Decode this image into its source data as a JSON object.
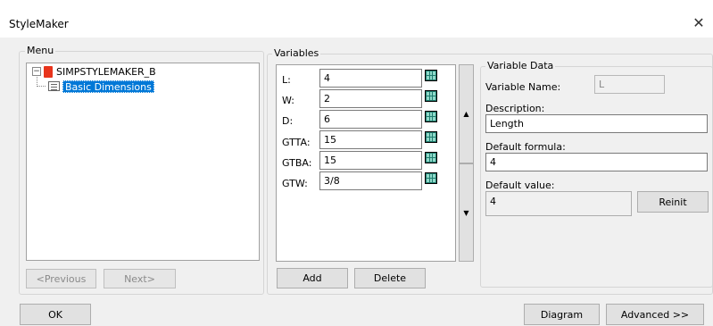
{
  "window": {
    "title": "StyleMaker",
    "close_glyph": "✕"
  },
  "menu": {
    "group_label": "Menu",
    "tree": {
      "root_label": "SIMPSTYLEMAKER_B",
      "root_toggle": "⊟",
      "child_label": "Basic Dimensions"
    },
    "previous_label": "<Previous",
    "next_label": "Next>"
  },
  "variables": {
    "group_label": "Variables",
    "rows": [
      {
        "name": "L:",
        "value": "4"
      },
      {
        "name": "W:",
        "value": "2"
      },
      {
        "name": "D:",
        "value": "6"
      },
      {
        "name": "GTTA:",
        "value": "15"
      },
      {
        "name": "GTBA:",
        "value": "15"
      },
      {
        "name": "GTW:",
        "value": "3/8"
      }
    ],
    "up_glyph": "▲",
    "down_glyph": "▼",
    "add_label": "Add",
    "delete_label": "Delete"
  },
  "variable_data": {
    "group_label": "Variable Data",
    "name_label": "Variable Name:",
    "name_value": "L",
    "description_label": "Description:",
    "description_value": "Length",
    "formula_label": "Default formula:",
    "formula_value": "4",
    "default_value_label": "Default value:",
    "default_value": "4",
    "reinit_label": "Reinit"
  },
  "footer": {
    "ok_label": "OK",
    "diagram_label": "Diagram",
    "advanced_label": "Advanced >>"
  }
}
